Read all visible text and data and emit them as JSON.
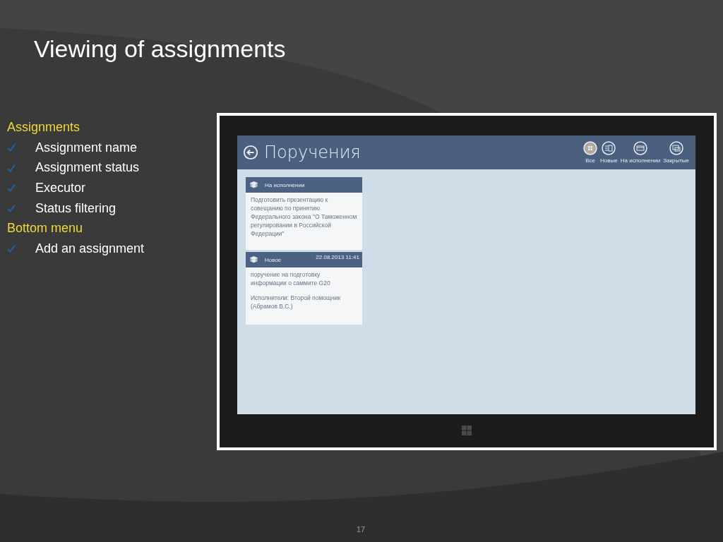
{
  "slide": {
    "title": "Viewing of assignments",
    "page_number": "17"
  },
  "outline": [
    {
      "kind": "heading",
      "text": "Assignments"
    },
    {
      "kind": "bullet",
      "text": "Assignment name"
    },
    {
      "kind": "bullet",
      "text": "Assignment status"
    },
    {
      "kind": "bullet",
      "text": "Executor"
    },
    {
      "kind": "bullet",
      "text": "Status filtering"
    },
    {
      "kind": "heading",
      "text": "Bottom menu"
    },
    {
      "kind": "bullet",
      "text": "Add an assignment"
    }
  ],
  "app": {
    "title": "Поручения",
    "filters": [
      {
        "label": "Все",
        "selected": true
      },
      {
        "label": "Новые",
        "selected": false
      },
      {
        "label": "На исполнении",
        "selected": false
      },
      {
        "label": "Закрытые",
        "selected": false
      }
    ],
    "cards": [
      {
        "status": "На исполнении",
        "text": "Подготовить презентацию к совещанию по принятию Федерального закона \"О Таможенном регулировании в Российской Федерации\""
      },
      {
        "status": "Новое",
        "date": "22.08.2013 11:41",
        "text": "поручение на подготовку информации о саммите G20",
        "executors": "Исполнители:  Второй помощник (Абрамов В.С.)"
      }
    ]
  }
}
